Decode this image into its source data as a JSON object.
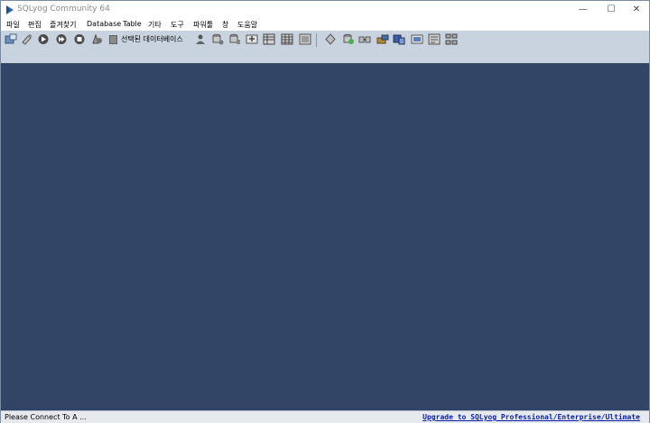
{
  "window": {
    "title": "SQLyog Community 64",
    "minimize_glyph": "—",
    "maximize_glyph": "☐",
    "close_glyph": "✕"
  },
  "menu": {
    "items": [
      {
        "label": "파일"
      },
      {
        "label": "편집"
      },
      {
        "label": "즐겨찾기"
      },
      {
        "label": "Database"
      },
      {
        "label": "Table"
      },
      {
        "label": "기타"
      },
      {
        "label": "도구"
      },
      {
        "label": "파워툴"
      },
      {
        "label": "창"
      },
      {
        "label": "도움말"
      }
    ]
  },
  "toolbar": {
    "db_selector_label": "선택된 데이터베이스",
    "icons": [
      "new-connection-icon",
      "disconnect-icon",
      "execute-query-icon",
      "execute-all-icon",
      "stop-icon",
      "refresh-icon",
      "user-manager-icon",
      "backup-icon",
      "restore-icon",
      "import-icon",
      "table-data-icon",
      "export-icon",
      "schema-designer-icon",
      "query-builder-icon",
      "sync-icon",
      "migration-icon",
      "scheduled-jobs-icon",
      "notifications-icon",
      "sql-formatter-icon",
      "history-icon"
    ]
  },
  "status": {
    "text": "Please Connect To A ...",
    "upgrade_link": "Upgrade to SQLyog Professional/Enterprise/Ultimate"
  },
  "colors": {
    "workspace": "#334567",
    "toolbar": "#c9d3e0",
    "link": "#0a1ea8"
  }
}
